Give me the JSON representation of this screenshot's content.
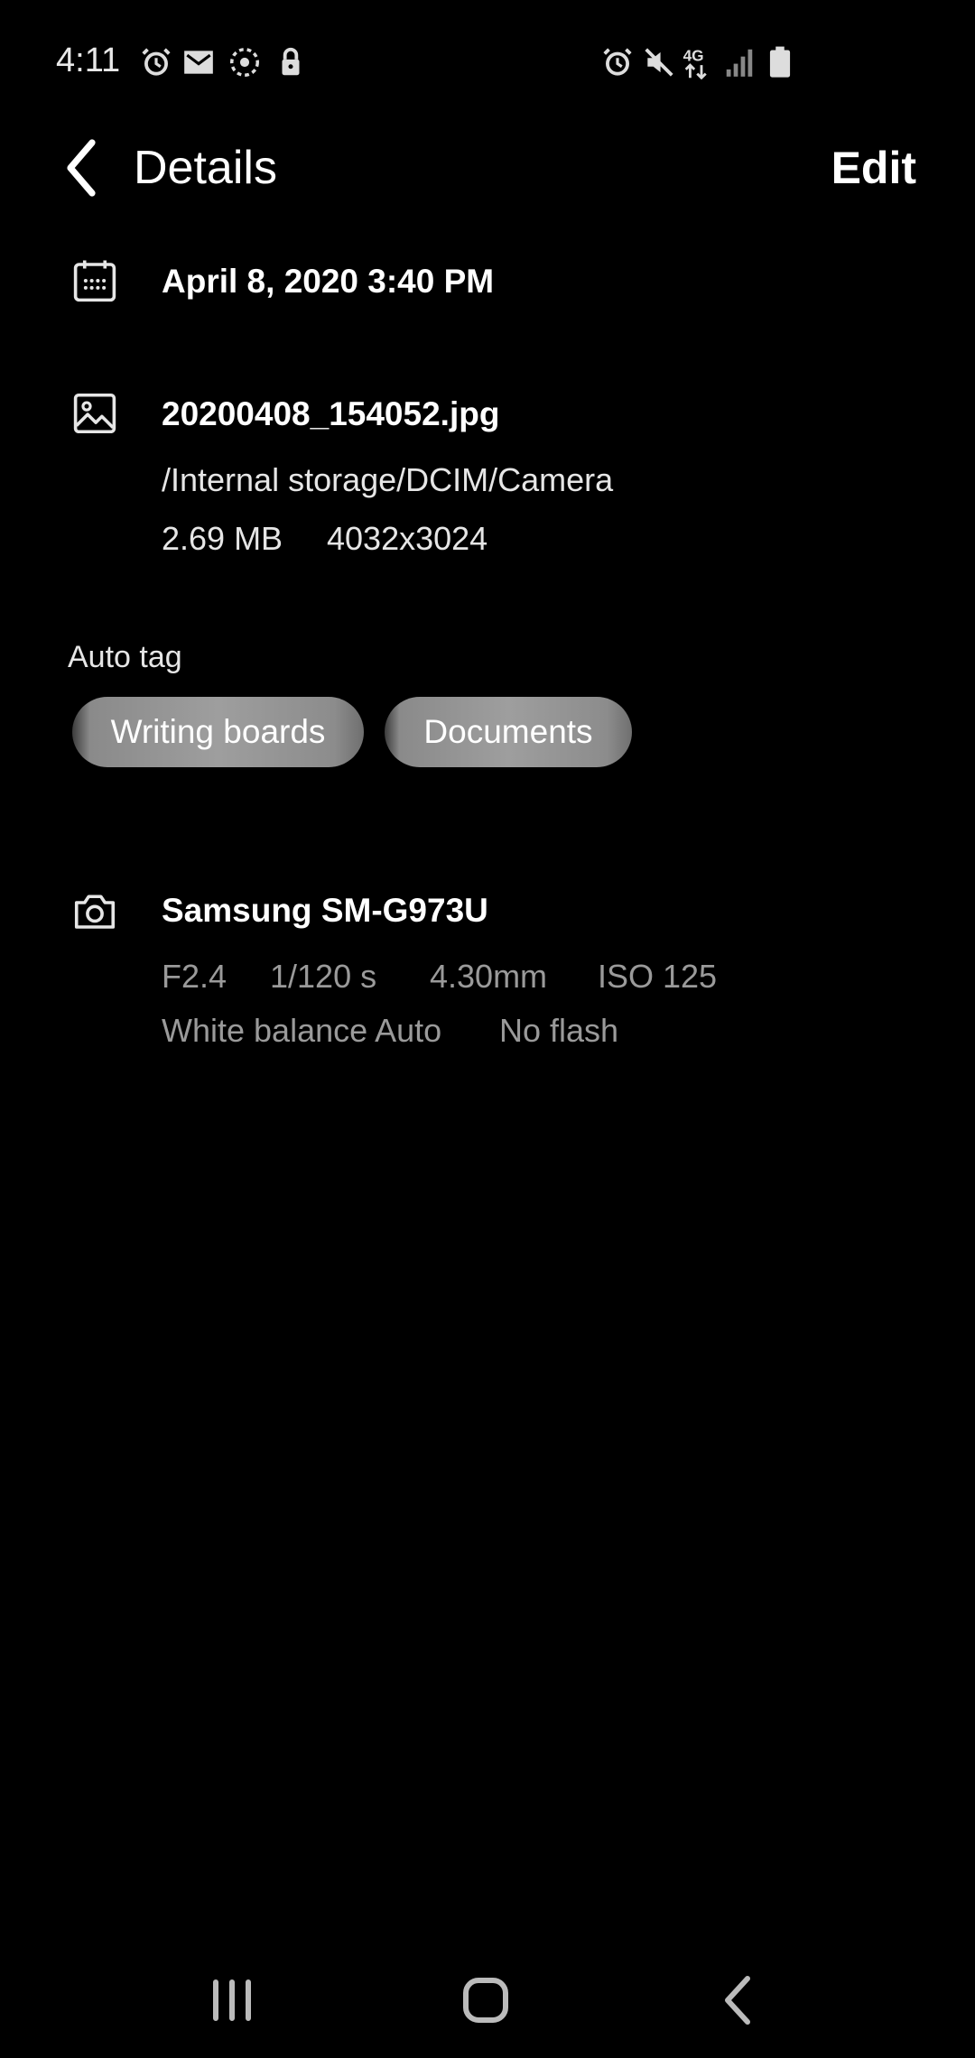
{
  "status_bar": {
    "time": "4:11",
    "left_icons": [
      "alarm-icon",
      "gmail-icon",
      "sync-icon",
      "lock-icon"
    ],
    "right_icons": [
      "alarm-icon",
      "mute-icon",
      "4g-lte-icon",
      "signal-icon",
      "battery-icon"
    ],
    "network_label": "4G"
  },
  "header": {
    "title": "Details",
    "edit_label": "Edit"
  },
  "date_row": {
    "icon": "calendar-icon",
    "datetime": "April 8, 2020 3:40 PM"
  },
  "file_row": {
    "icon": "image-icon",
    "filename": "20200408_154052.jpg",
    "path": "/Internal storage/DCIM/Camera",
    "size": "2.69 MB",
    "resolution": "4032x3024"
  },
  "auto_tag": {
    "label": "Auto tag",
    "tags": [
      "Writing boards",
      "Documents"
    ]
  },
  "camera_row": {
    "icon": "camera-icon",
    "model": "Samsung SM-G973U",
    "aperture": "F2.4",
    "shutter": "1/120 s",
    "focal_length": "4.30mm",
    "iso": "ISO 125",
    "white_balance": "White balance Auto",
    "flash": "No flash"
  },
  "nav_bar": {
    "buttons": [
      "recent-apps-icon",
      "home-icon",
      "back-icon"
    ]
  },
  "colors": {
    "background": "#000000",
    "text_primary": "#ffffff",
    "text_meta": "#9a9a9a",
    "chip": "#9e9e9e"
  }
}
